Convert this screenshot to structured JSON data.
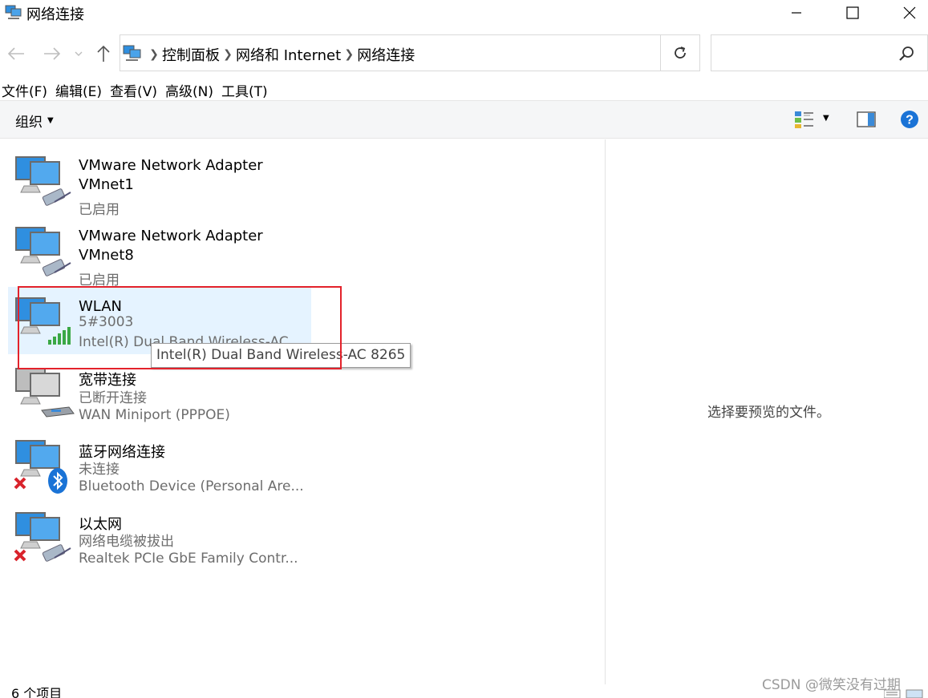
{
  "window": {
    "title": "网络连接",
    "icon": "network-connections-icon"
  },
  "address_bar": {
    "crumbs": [
      "控制面板",
      "网络和 Internet",
      "网络连接"
    ],
    "search_placeholder": ""
  },
  "menu": [
    "文件(F)",
    "编辑(E)",
    "查看(V)",
    "高级(N)",
    "工具(T)"
  ],
  "command_bar": {
    "organize": "组织"
  },
  "items": [
    {
      "name": "VMware Network Adapter",
      "name2": "VMnet1",
      "status": "已启用",
      "device": "",
      "icon": "ethernet-adapter-icon"
    },
    {
      "name": "VMware Network Adapter",
      "name2": "VMnet8",
      "status": "已启用",
      "device": "",
      "icon": "ethernet-adapter-icon"
    },
    {
      "name": "WLAN",
      "status": "5#3003",
      "device": "Intel(R) Dual Band Wireless-AC",
      "icon": "wifi-adapter-icon",
      "selected": true
    },
    {
      "name": "宽带连接",
      "status": "已断开连接",
      "device": "WAN Miniport (PPPOE)",
      "icon": "broadband-icon"
    },
    {
      "name": "蓝牙网络连接",
      "status": "未连接",
      "device": "Bluetooth Device (Personal Are...",
      "icon": "bluetooth-adapter-icon"
    },
    {
      "name": "以太网",
      "status": "网络电缆被拔出",
      "device": "Realtek PCIe GbE Family Contr...",
      "icon": "ethernet-adapter-icon"
    }
  ],
  "tooltip": "Intel(R) Dual Band Wireless-AC 8265",
  "preview": "选择要预览的文件。",
  "status_bar": {
    "count": "6 个项目"
  },
  "watermark": "CSDN @微笑没有过期",
  "colors": {
    "selection": "#e5f3ff",
    "highlight_border": "#e3222b",
    "monitor_blue": "#2f8fe0",
    "signal_green": "#3aa845",
    "error_red": "#d9232c",
    "help_blue": "#1a73d6"
  }
}
